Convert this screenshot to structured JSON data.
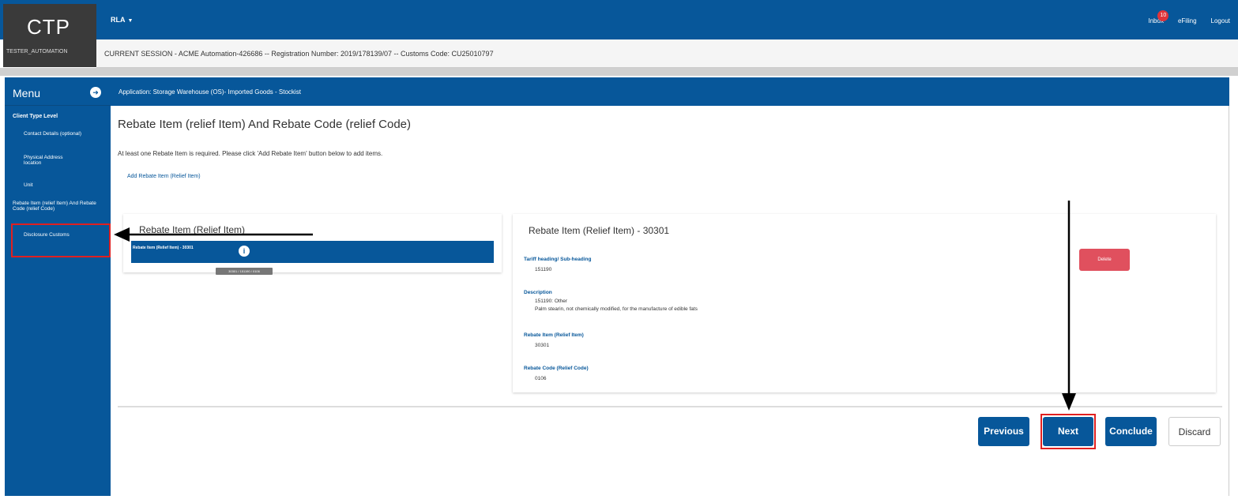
{
  "header": {
    "logo": "CTP",
    "username": "TESTER_AUTOMATION",
    "rla_label": "RLA",
    "inbox_label": "Inbox",
    "inbox_count": "10",
    "efiling_label": "eFiling",
    "logout_label": "Logout"
  },
  "session": {
    "text": "CURRENT SESSION - ACME Automation-426686 -- Registration Number: 2019/178139/07 -- Customs Code: CU25010797"
  },
  "application": {
    "title": "Application: Storage Warehouse (OS)- Imported Goods - Stockist"
  },
  "sidebar": {
    "menu_label": "Menu",
    "section": "Client Type Level",
    "items": [
      {
        "label": "Contact Details (optional)"
      },
      {
        "label": "Physical Address location"
      },
      {
        "label": "Unit"
      },
      {
        "label": "Rebate Item (relief Item) And Rebate Code (relief Code)"
      },
      {
        "label": "Disclosure Customs"
      }
    ]
  },
  "main": {
    "page_title": "Rebate Item (relief Item) And Rebate Code (relief Code)",
    "notice": "At least one Rebate Item is required. Please click 'Add Rebate Item' button below to add items.",
    "add_link": "Add Rebate Item (Relief Item)",
    "left_card": {
      "title": "Rebate Item (Relief Item)",
      "row_label": "Rebate Item (Relief Item) - 30301",
      "tooltip": "30301 / 151190 / 0106"
    },
    "right_card": {
      "title": "Rebate Item (Relief Item) - 30301",
      "tariff_label": "Tariff heading/ Sub-heading",
      "tariff_value": "151190",
      "description_label": "Description",
      "description_line1": "151190: Other",
      "description_line2": "Palm stearin, not chemically modified, for the manufacture of edible fats",
      "rebate_item_label": "Rebate Item (Relief Item)",
      "rebate_item_value": "30301",
      "rebate_code_label": "Rebate Code (Relief Code)",
      "rebate_code_value": "0106",
      "delete_label": "Delete"
    }
  },
  "footer": {
    "previous_label": "Previous",
    "next_label": "Next",
    "conclude_label": "Conclude",
    "discard_label": "Discard"
  },
  "colors": {
    "primary": "#07579a",
    "highlight": "#e02020",
    "delete": "#e0505e"
  }
}
